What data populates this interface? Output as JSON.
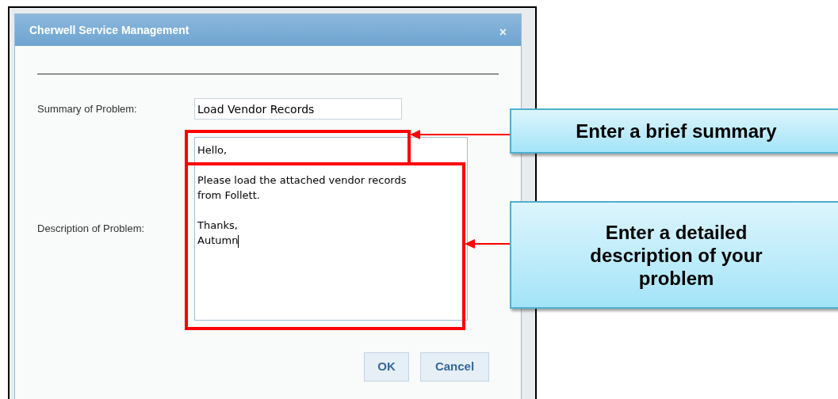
{
  "dialog": {
    "title": "Cherwell Service Management",
    "close": "×",
    "fields": [
      {
        "label": "Summary of Problem:",
        "value": "Load Vendor Records"
      },
      {
        "label": "Description of Problem:",
        "value": "Hello,\n\nPlease load the attached vendor records\nfrom Follett.\n\nThanks,\nAutumn"
      }
    ],
    "buttons": [
      "OK",
      "Cancel"
    ]
  },
  "callouts": [
    "Enter a brief summary",
    "Enter a detailed description of your problem"
  ]
}
